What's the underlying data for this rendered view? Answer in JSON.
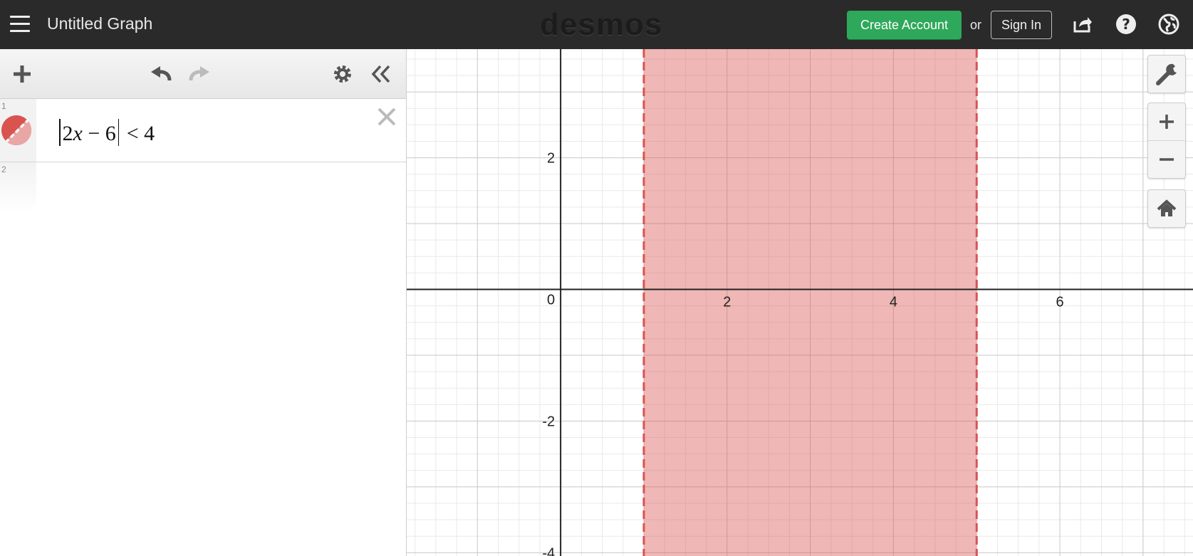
{
  "header": {
    "menu_icon": "hamburger-menu-icon",
    "title": "Untitled Graph",
    "brand": "desmos",
    "create_account_label": "Create Account",
    "or_label": "or",
    "sign_in_label": "Sign In",
    "icons": [
      "share-icon",
      "help-icon",
      "language-globe-icon"
    ],
    "create_account_color": "#2ea85a"
  },
  "toolbar": {
    "icons": [
      "add-icon",
      "undo-icon",
      "redo-icon",
      "settings-gear-icon",
      "collapse-panel-icon"
    ]
  },
  "expressions": [
    {
      "index": "1",
      "latex": "|2x - 6| < 4",
      "color": "#d9534f"
    },
    {
      "index": "2",
      "latex": ""
    }
  ],
  "graph": {
    "x_ticks": [
      "2",
      "4",
      "6"
    ],
    "y_ticks": [
      "2",
      "-2",
      "-4"
    ],
    "origin_label": "0",
    "x_range": [
      -1.85,
      7.6
    ],
    "y_range": [
      -4.05,
      3.65
    ],
    "shaded_region": {
      "x_min": 1,
      "x_max": 5,
      "boundary": "dashed",
      "color": "#d9534f"
    },
    "controls": [
      "wrench-settings-icon",
      "zoom-in-icon",
      "zoom-out-icon",
      "home-icon"
    ]
  }
}
